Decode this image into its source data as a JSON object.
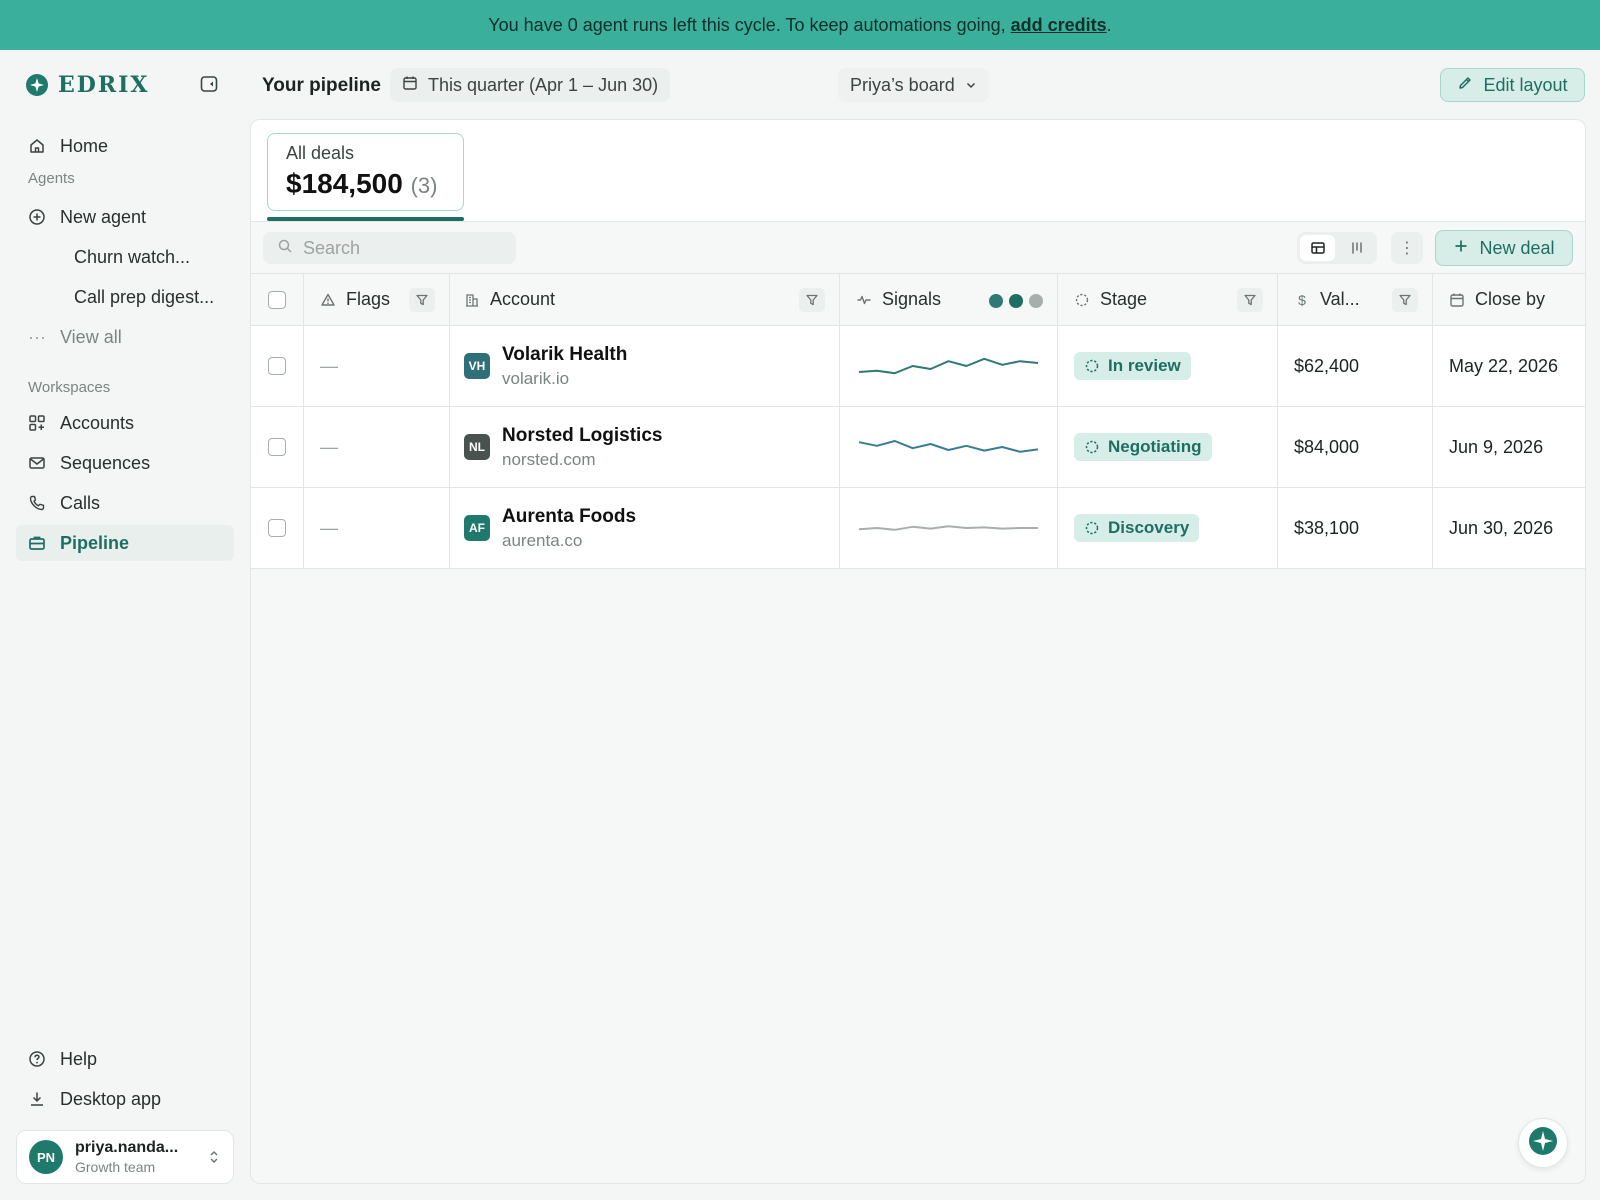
{
  "banner": {
    "text": "You have 0 agent runs left this cycle. To keep automations going,",
    "link": "add credits",
    "suffix": "."
  },
  "brand": {
    "name": "EDRIX",
    "color": "#1f6e62"
  },
  "sidebar": {
    "home": "Home",
    "agents_label": "Agents",
    "new_agent": "New agent",
    "agents": [
      "Churn watch...",
      "Call prep digest..."
    ],
    "view_all": "View all",
    "workspaces_label": "Workspaces",
    "workspaces": [
      "Accounts",
      "Sequences",
      "Calls",
      "Pipeline"
    ],
    "active": "Pipeline",
    "help": "Help",
    "desktop_app": "Desktop app"
  },
  "user": {
    "initials": "PN",
    "name": "priya.nanda...",
    "team": "Growth team"
  },
  "header": {
    "title": "Your pipeline",
    "date_range": "This quarter (Apr 1 – Jun 30)",
    "board": "Priya’s board",
    "edit_layout": "Edit layout"
  },
  "summary": {
    "label": "All deals",
    "value": "$184,500",
    "count": "(3)"
  },
  "toolbar": {
    "search_placeholder": "Search",
    "new_deal": "New deal"
  },
  "columns": {
    "flags": "Flags",
    "account": "Account",
    "signals": "Signals",
    "stage": "Stage",
    "value": "Val...",
    "close": "Close by"
  },
  "signal_dots": [
    "#2f7a74",
    "#1f6e62",
    "#a6afac"
  ],
  "deals": [
    {
      "flags": "—",
      "initials": "VH",
      "badge_color": "#2f6f7a",
      "name": "Volarik Health",
      "domain": "volarik.io",
      "trend": [
        40,
        42,
        38,
        50,
        45,
        58,
        50,
        62,
        52,
        58,
        55
      ],
      "trend_color": "#2f7a74",
      "stage": "In review",
      "value": "$62,400",
      "close": "May 22, 2026"
    },
    {
      "flags": "—",
      "initials": "NL",
      "badge_color": "#4a5250",
      "name": "Norsted Logistics",
      "domain": "norsted.com",
      "trend": [
        58,
        52,
        60,
        48,
        55,
        45,
        52,
        44,
        50,
        42,
        46
      ],
      "trend_color": "#3a7c94",
      "stage": "Negotiating",
      "value": "$84,000",
      "close": "Jun 9, 2026"
    },
    {
      "flags": "—",
      "initials": "AF",
      "badge_color": "#1f7a6c",
      "name": "Aurenta Foods",
      "domain": "aurenta.co",
      "trend": [
        48,
        50,
        47,
        52,
        49,
        53,
        50,
        51,
        49,
        50,
        50
      ],
      "trend_color": "#a6afac",
      "stage": "Discovery",
      "value": "$38,100",
      "close": "Jun 30, 2026"
    }
  ]
}
